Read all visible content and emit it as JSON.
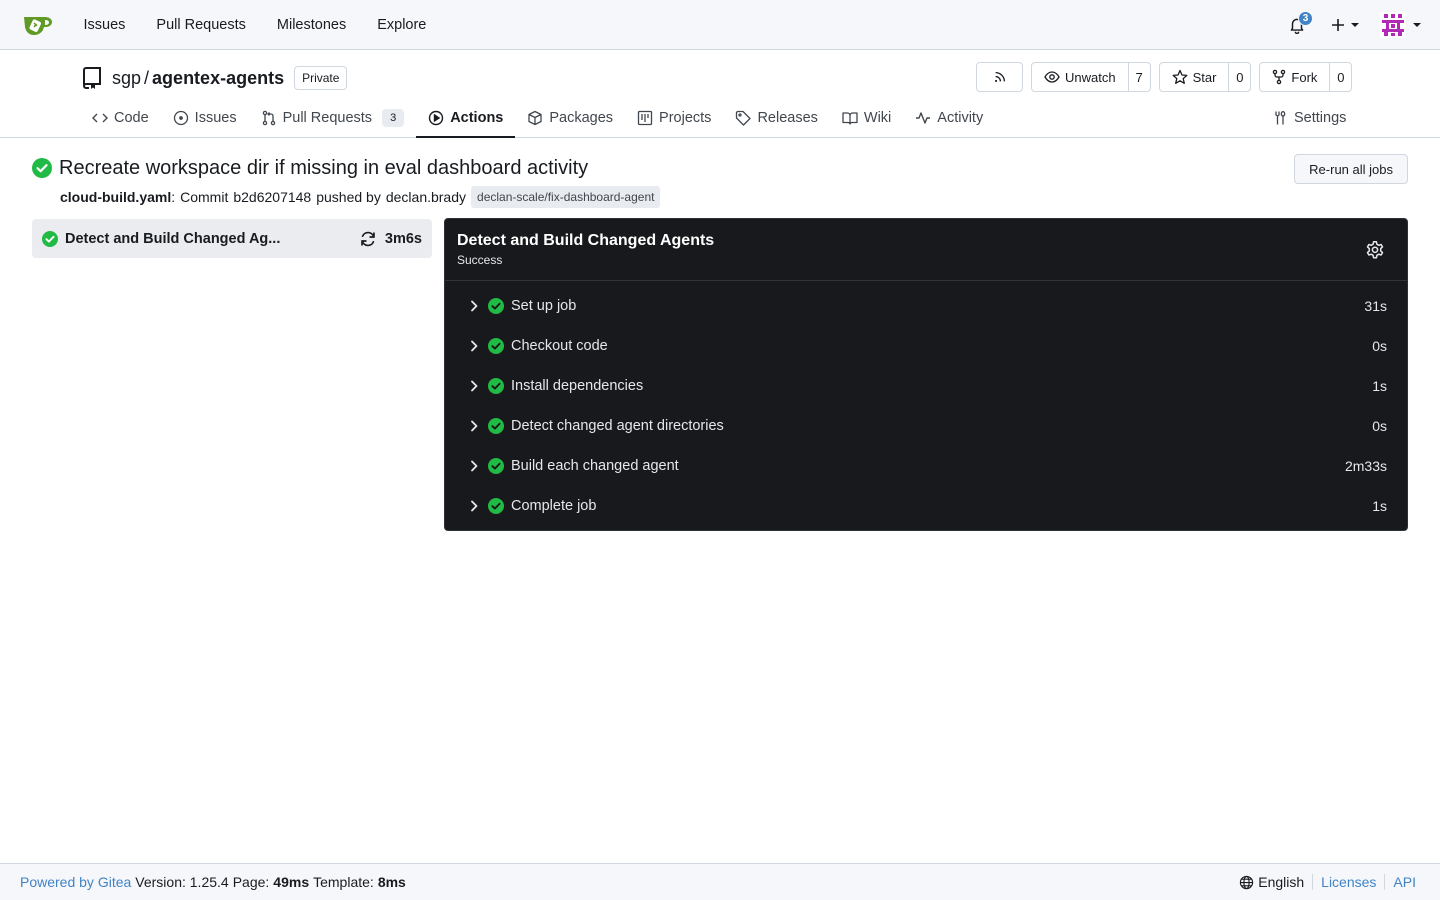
{
  "colors": {
    "success": "#21ba45",
    "link": "#4183c4",
    "logo": "#609926",
    "dark_panel": "#17191c"
  },
  "navbar": {
    "logo_icon": "gitea-logo",
    "links": [
      "Issues",
      "Pull Requests",
      "Milestones",
      "Explore"
    ],
    "notification_count": "3",
    "create_icon": "plus-icon",
    "avatar_icon": "identicon-avatar"
  },
  "repo": {
    "owner": "sgp",
    "separator": "/",
    "name": "agentex-agents",
    "visibility": "Private",
    "watch_label": "Unwatch",
    "watch_count": "7",
    "star_label": "Star",
    "star_count": "0",
    "fork_label": "Fork",
    "fork_count": "0",
    "tabs": [
      {
        "label": "Code",
        "icon": "code-icon"
      },
      {
        "label": "Issues",
        "icon": "issue-icon"
      },
      {
        "label": "Pull Requests",
        "icon": "pull-request-icon",
        "count": "3"
      },
      {
        "label": "Actions",
        "icon": "play-icon",
        "active": true
      },
      {
        "label": "Packages",
        "icon": "package-icon"
      },
      {
        "label": "Projects",
        "icon": "project-icon"
      },
      {
        "label": "Releases",
        "icon": "tag-icon"
      },
      {
        "label": "Wiki",
        "icon": "book-icon"
      },
      {
        "label": "Activity",
        "icon": "pulse-icon"
      }
    ],
    "settings_label": "Settings"
  },
  "run": {
    "title": "Recreate workspace dir if missing in eval dashboard activity",
    "workflow": "cloud-build.yaml",
    "workflow_suffix": ":",
    "commit_label": "Commit",
    "commit_sha": "b2d6207148",
    "pushed_by_label": "pushed by",
    "author": "declan.brady",
    "branch": "declan-scale/fix-dashboard-agent",
    "rerun_label": "Re-run all jobs"
  },
  "jobs": [
    {
      "name": "Detect and Build Changed Ag...",
      "duration": "3m6s"
    }
  ],
  "job_detail": {
    "title": "Detect and Build Changed Agents",
    "status": "Success",
    "steps": [
      {
        "name": "Set up job",
        "duration": "31s"
      },
      {
        "name": "Checkout code",
        "duration": "0s"
      },
      {
        "name": "Install dependencies",
        "duration": "1s"
      },
      {
        "name": "Detect changed agent directories",
        "duration": "0s"
      },
      {
        "name": "Build each changed agent",
        "duration": "2m33s"
      },
      {
        "name": "Complete job",
        "duration": "1s"
      }
    ]
  },
  "footer": {
    "powered_by": "Powered by Gitea",
    "version_label": "Version: 1.25.4",
    "page_label": "Page:",
    "page_time": "49ms",
    "template_label": "Template:",
    "template_time": "8ms",
    "language": "English",
    "licenses": "Licenses",
    "api": "API"
  }
}
